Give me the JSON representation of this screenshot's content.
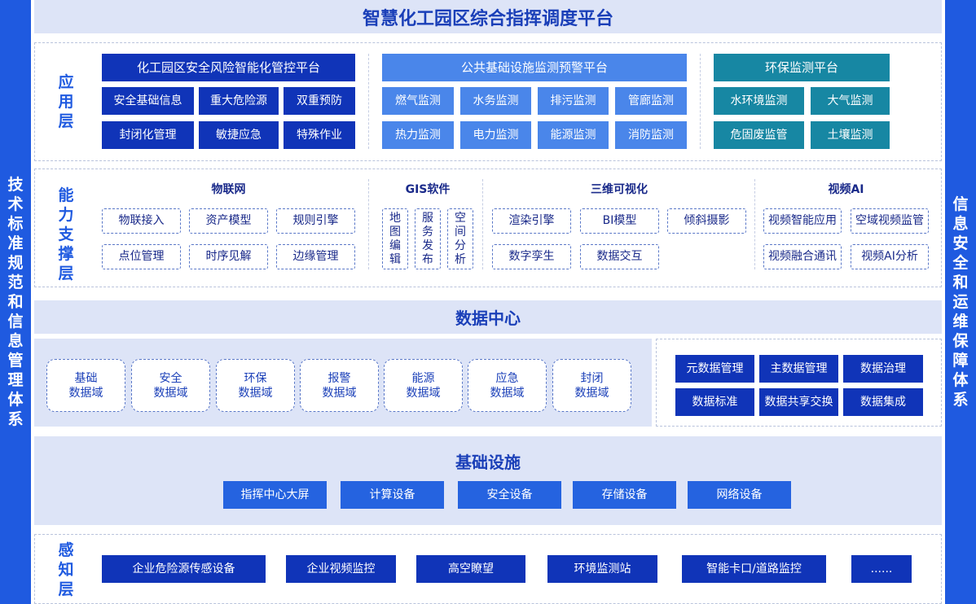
{
  "title": "智慧化工园区综合指挥调度平台",
  "left_side": "技术标准规范和信息管理体系",
  "right_side": "信息安全和运维保障体系",
  "application_layer": {
    "label": "应用层",
    "groups": [
      {
        "title": "化工园区安全风险智能化管控平台",
        "items": [
          "安全基础信息",
          "重大危险源",
          "双重预防",
          "封闭化管理",
          "敏捷应急",
          "特殊作业"
        ]
      },
      {
        "title": "公共基础设施监测预警平台",
        "items": [
          "燃气监测",
          "水务监测",
          "排污监测",
          "管廊监测",
          "热力监测",
          "电力监测",
          "能源监测",
          "消防监测"
        ]
      },
      {
        "title": "环保监测平台",
        "items": [
          "水环境监测",
          "大气监测",
          "危固废监管",
          "土壤监测"
        ]
      }
    ]
  },
  "capability_layer": {
    "label": "能力支撑层",
    "iot": {
      "title": "物联网",
      "items": [
        "物联接入",
        "资产模型",
        "规则引擎",
        "点位管理",
        "时序见解",
        "边缘管理"
      ]
    },
    "gis": {
      "title": "GIS软件",
      "items": [
        "地图编辑",
        "服务发布",
        "空间分析"
      ]
    },
    "viz3d": {
      "title": "三维可视化",
      "items": [
        "渲染引擎",
        "BI模型",
        "倾斜摄影",
        "数字孪生",
        "数据交互"
      ]
    },
    "video": {
      "title": "视频AI",
      "items": [
        "视频智能应用",
        "空域视频监管",
        "视频融合通讯",
        "视频AI分析"
      ]
    }
  },
  "data_center": {
    "title": "数据中心",
    "domains": [
      "基础\n数据域",
      "安全\n数据域",
      "环保\n数据域",
      "报警\n数据域",
      "能源\n数据域",
      "应急\n数据域",
      "封闭\n数据域"
    ],
    "management": [
      "元数据管理",
      "主数据管理",
      "数据治理",
      "数据标准",
      "数据共享交换",
      "数据集成"
    ]
  },
  "infrastructure": {
    "title": "基础设施",
    "items": [
      "指挥中心大屏",
      "计算设备",
      "安全设备",
      "存储设备",
      "网络设备"
    ]
  },
  "perception_layer": {
    "label": "感知层",
    "items": [
      "企业危险源传感设备",
      "企业视频监控",
      "高空瞭望",
      "环境监测站",
      "智能卡口/道路监控",
      "......"
    ]
  },
  "colors": {
    "side_bar": "#1f5ae0",
    "band": "#dde4f7",
    "navy": "#1034b8",
    "light_blue": "#4a86ea",
    "teal": "#1787a3",
    "bright_blue": "#2563e0"
  }
}
